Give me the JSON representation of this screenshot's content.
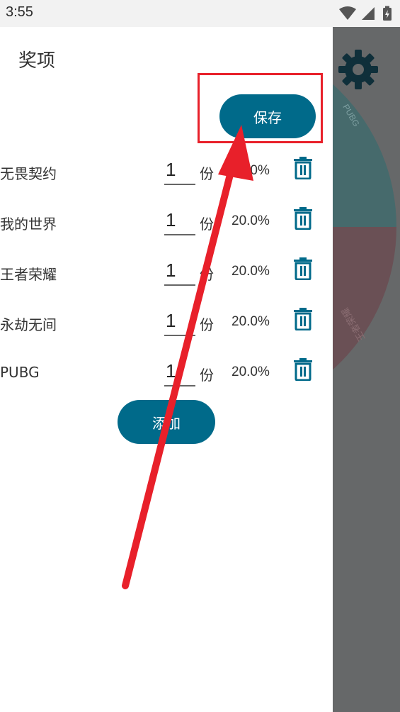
{
  "status_bar": {
    "time": "3:55"
  },
  "drawer": {
    "title": "奖项",
    "save_label": "保存",
    "add_label": "添加",
    "unit_label": "份",
    "prizes": [
      {
        "name": "无畏契约",
        "quantity": "1",
        "percent": "20.0%"
      },
      {
        "name": "我的世界",
        "quantity": "1",
        "percent": "20.0%"
      },
      {
        "name": "王者荣耀",
        "quantity": "1",
        "percent": "20.0%"
      },
      {
        "name": "永劫无间",
        "quantity": "1",
        "percent": "20.0%"
      },
      {
        "name": "PUBG",
        "quantity": "1",
        "percent": "20.0%"
      }
    ]
  },
  "background": {
    "wheel_labels": [
      "PUBG",
      "王者荣耀"
    ],
    "colors": {
      "teal_slice": "#466a6c",
      "red_slice": "#6a5055",
      "scrim": "#666869"
    }
  },
  "colors": {
    "accent": "#006a8a",
    "annotation": "#e8202a"
  },
  "icons": [
    "signal-icon",
    "wifi-icon",
    "battery-icon",
    "gear-icon",
    "trash-icon"
  ]
}
